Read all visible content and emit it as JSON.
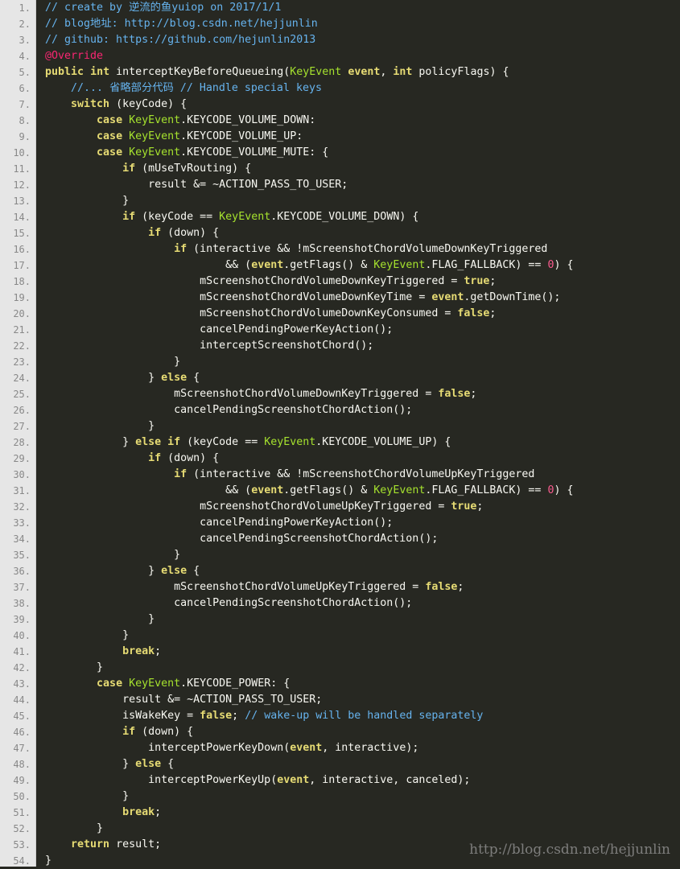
{
  "colors": {
    "background": "#272822",
    "gutter": "#e6e6e6",
    "line_number": "#888888",
    "comment": "#66b3ee",
    "keyword": "#e6db74",
    "type": "#a6e22e",
    "annotation": "#f92672",
    "number": "#f95b8e",
    "default": "#f8f8f2"
  },
  "watermark": "http://blog.csdn.net/hejjunlin",
  "code_lines": [
    {
      "num": "1.",
      "tokens": [
        {
          "t": "cmt",
          "v": "// create by 逆流的鱼yuiop on 2017/1/1"
        }
      ]
    },
    {
      "num": "2.",
      "tokens": [
        {
          "t": "cmt",
          "v": "// blog地址: http://blog.csdn.net/hejjunlin"
        }
      ]
    },
    {
      "num": "3.",
      "tokens": [
        {
          "t": "cmt",
          "v": "// github: https://github.com/hejunlin2013"
        }
      ]
    },
    {
      "num": "4.",
      "tokens": [
        {
          "t": "ann",
          "v": "@Override"
        }
      ]
    },
    {
      "num": "5.",
      "tokens": [
        {
          "t": "kw",
          "v": "public"
        },
        {
          "t": "def",
          "v": " "
        },
        {
          "t": "kw",
          "v": "int"
        },
        {
          "t": "def",
          "v": " interceptKeyBeforeQueueing("
        },
        {
          "t": "typ",
          "v": "KeyEvent"
        },
        {
          "t": "def",
          "v": " "
        },
        {
          "t": "kw",
          "v": "event"
        },
        {
          "t": "def",
          "v": ", "
        },
        {
          "t": "kw",
          "v": "int"
        },
        {
          "t": "def",
          "v": " policyFlags) {"
        }
      ]
    },
    {
      "num": "6.",
      "tokens": [
        {
          "t": "def",
          "v": "    "
        },
        {
          "t": "cmt",
          "v": "//... 省略部分代码 // Handle special keys"
        }
      ]
    },
    {
      "num": "7.",
      "tokens": [
        {
          "t": "def",
          "v": "    "
        },
        {
          "t": "kw",
          "v": "switch"
        },
        {
          "t": "def",
          "v": " (keyCode) {"
        }
      ]
    },
    {
      "num": "8.",
      "tokens": [
        {
          "t": "def",
          "v": "        "
        },
        {
          "t": "kw",
          "v": "case"
        },
        {
          "t": "def",
          "v": " "
        },
        {
          "t": "typ",
          "v": "KeyEvent"
        },
        {
          "t": "def",
          "v": ".KEYCODE_VOLUME_DOWN:"
        }
      ]
    },
    {
      "num": "9.",
      "tokens": [
        {
          "t": "def",
          "v": "        "
        },
        {
          "t": "kw",
          "v": "case"
        },
        {
          "t": "def",
          "v": " "
        },
        {
          "t": "typ",
          "v": "KeyEvent"
        },
        {
          "t": "def",
          "v": ".KEYCODE_VOLUME_UP:"
        }
      ]
    },
    {
      "num": "10.",
      "tokens": [
        {
          "t": "def",
          "v": "        "
        },
        {
          "t": "kw",
          "v": "case"
        },
        {
          "t": "def",
          "v": " "
        },
        {
          "t": "typ",
          "v": "KeyEvent"
        },
        {
          "t": "def",
          "v": ".KEYCODE_VOLUME_MUTE: {"
        }
      ]
    },
    {
      "num": "11.",
      "tokens": [
        {
          "t": "def",
          "v": "            "
        },
        {
          "t": "kw",
          "v": "if"
        },
        {
          "t": "def",
          "v": " (mUseTvRouting) {"
        }
      ]
    },
    {
      "num": "12.",
      "tokens": [
        {
          "t": "def",
          "v": "                result &= ~ACTION_PASS_TO_USER;"
        }
      ]
    },
    {
      "num": "13.",
      "tokens": [
        {
          "t": "def",
          "v": "            }"
        }
      ]
    },
    {
      "num": "14.",
      "tokens": [
        {
          "t": "def",
          "v": "            "
        },
        {
          "t": "kw",
          "v": "if"
        },
        {
          "t": "def",
          "v": " (keyCode == "
        },
        {
          "t": "typ",
          "v": "KeyEvent"
        },
        {
          "t": "def",
          "v": ".KEYCODE_VOLUME_DOWN) {"
        }
      ]
    },
    {
      "num": "15.",
      "tokens": [
        {
          "t": "def",
          "v": "                "
        },
        {
          "t": "kw",
          "v": "if"
        },
        {
          "t": "def",
          "v": " (down) {"
        }
      ]
    },
    {
      "num": "16.",
      "tokens": [
        {
          "t": "def",
          "v": "                    "
        },
        {
          "t": "kw",
          "v": "if"
        },
        {
          "t": "def",
          "v": " (interactive && !mScreenshotChordVolumeDownKeyTriggered"
        }
      ]
    },
    {
      "num": "17.",
      "tokens": [
        {
          "t": "def",
          "v": "                            && ("
        },
        {
          "t": "kw",
          "v": "event"
        },
        {
          "t": "def",
          "v": ".getFlags() & "
        },
        {
          "t": "typ",
          "v": "KeyEvent"
        },
        {
          "t": "def",
          "v": ".FLAG_FALLBACK) == "
        },
        {
          "t": "num",
          "v": "0"
        },
        {
          "t": "def",
          "v": ") {"
        }
      ]
    },
    {
      "num": "18.",
      "tokens": [
        {
          "t": "def",
          "v": "                        mScreenshotChordVolumeDownKeyTriggered = "
        },
        {
          "t": "kw",
          "v": "true"
        },
        {
          "t": "def",
          "v": ";"
        }
      ]
    },
    {
      "num": "19.",
      "tokens": [
        {
          "t": "def",
          "v": "                        mScreenshotChordVolumeDownKeyTime = "
        },
        {
          "t": "kw",
          "v": "event"
        },
        {
          "t": "def",
          "v": ".getDownTime();"
        }
      ]
    },
    {
      "num": "20.",
      "tokens": [
        {
          "t": "def",
          "v": "                        mScreenshotChordVolumeDownKeyConsumed = "
        },
        {
          "t": "kw",
          "v": "false"
        },
        {
          "t": "def",
          "v": ";"
        }
      ]
    },
    {
      "num": "21.",
      "tokens": [
        {
          "t": "def",
          "v": "                        cancelPendingPowerKeyAction();"
        }
      ]
    },
    {
      "num": "22.",
      "tokens": [
        {
          "t": "def",
          "v": "                        interceptScreenshotChord();"
        }
      ]
    },
    {
      "num": "23.",
      "tokens": [
        {
          "t": "def",
          "v": "                    }"
        }
      ]
    },
    {
      "num": "24.",
      "tokens": [
        {
          "t": "def",
          "v": "                } "
        },
        {
          "t": "kw",
          "v": "else"
        },
        {
          "t": "def",
          "v": " {"
        }
      ]
    },
    {
      "num": "25.",
      "tokens": [
        {
          "t": "def",
          "v": "                    mScreenshotChordVolumeDownKeyTriggered = "
        },
        {
          "t": "kw",
          "v": "false"
        },
        {
          "t": "def",
          "v": ";"
        }
      ]
    },
    {
      "num": "26.",
      "tokens": [
        {
          "t": "def",
          "v": "                    cancelPendingScreenshotChordAction();"
        }
      ]
    },
    {
      "num": "27.",
      "tokens": [
        {
          "t": "def",
          "v": "                }"
        }
      ]
    },
    {
      "num": "28.",
      "tokens": [
        {
          "t": "def",
          "v": "            } "
        },
        {
          "t": "kw",
          "v": "else"
        },
        {
          "t": "def",
          "v": " "
        },
        {
          "t": "kw",
          "v": "if"
        },
        {
          "t": "def",
          "v": " (keyCode == "
        },
        {
          "t": "typ",
          "v": "KeyEvent"
        },
        {
          "t": "def",
          "v": ".KEYCODE_VOLUME_UP) {"
        }
      ]
    },
    {
      "num": "29.",
      "tokens": [
        {
          "t": "def",
          "v": "                "
        },
        {
          "t": "kw",
          "v": "if"
        },
        {
          "t": "def",
          "v": " (down) {"
        }
      ]
    },
    {
      "num": "30.",
      "tokens": [
        {
          "t": "def",
          "v": "                    "
        },
        {
          "t": "kw",
          "v": "if"
        },
        {
          "t": "def",
          "v": " (interactive && !mScreenshotChordVolumeUpKeyTriggered"
        }
      ]
    },
    {
      "num": "31.",
      "tokens": [
        {
          "t": "def",
          "v": "                            && ("
        },
        {
          "t": "kw",
          "v": "event"
        },
        {
          "t": "def",
          "v": ".getFlags() & "
        },
        {
          "t": "typ",
          "v": "KeyEvent"
        },
        {
          "t": "def",
          "v": ".FLAG_FALLBACK) == "
        },
        {
          "t": "num",
          "v": "0"
        },
        {
          "t": "def",
          "v": ") {"
        }
      ]
    },
    {
      "num": "32.",
      "tokens": [
        {
          "t": "def",
          "v": "                        mScreenshotChordVolumeUpKeyTriggered = "
        },
        {
          "t": "kw",
          "v": "true"
        },
        {
          "t": "def",
          "v": ";"
        }
      ]
    },
    {
      "num": "33.",
      "tokens": [
        {
          "t": "def",
          "v": "                        cancelPendingPowerKeyAction();"
        }
      ]
    },
    {
      "num": "34.",
      "tokens": [
        {
          "t": "def",
          "v": "                        cancelPendingScreenshotChordAction();"
        }
      ]
    },
    {
      "num": "35.",
      "tokens": [
        {
          "t": "def",
          "v": "                    }"
        }
      ]
    },
    {
      "num": "36.",
      "tokens": [
        {
          "t": "def",
          "v": "                } "
        },
        {
          "t": "kw",
          "v": "else"
        },
        {
          "t": "def",
          "v": " {"
        }
      ]
    },
    {
      "num": "37.",
      "tokens": [
        {
          "t": "def",
          "v": "                    mScreenshotChordVolumeUpKeyTriggered = "
        },
        {
          "t": "kw",
          "v": "false"
        },
        {
          "t": "def",
          "v": ";"
        }
      ]
    },
    {
      "num": "38.",
      "tokens": [
        {
          "t": "def",
          "v": "                    cancelPendingScreenshotChordAction();"
        }
      ]
    },
    {
      "num": "39.",
      "tokens": [
        {
          "t": "def",
          "v": "                }"
        }
      ]
    },
    {
      "num": "40.",
      "tokens": [
        {
          "t": "def",
          "v": "            }"
        }
      ]
    },
    {
      "num": "41.",
      "tokens": [
        {
          "t": "def",
          "v": "            "
        },
        {
          "t": "kw",
          "v": "break"
        },
        {
          "t": "def",
          "v": ";"
        }
      ]
    },
    {
      "num": "42.",
      "tokens": [
        {
          "t": "def",
          "v": "        }"
        }
      ]
    },
    {
      "num": "43.",
      "tokens": [
        {
          "t": "def",
          "v": "        "
        },
        {
          "t": "kw",
          "v": "case"
        },
        {
          "t": "def",
          "v": " "
        },
        {
          "t": "typ",
          "v": "KeyEvent"
        },
        {
          "t": "def",
          "v": ".KEYCODE_POWER: {"
        }
      ]
    },
    {
      "num": "44.",
      "tokens": [
        {
          "t": "def",
          "v": "            result &= ~ACTION_PASS_TO_USER;"
        }
      ]
    },
    {
      "num": "45.",
      "tokens": [
        {
          "t": "def",
          "v": "            isWakeKey = "
        },
        {
          "t": "kw",
          "v": "false"
        },
        {
          "t": "def",
          "v": "; "
        },
        {
          "t": "cmt",
          "v": "// wake-up will be handled separately"
        }
      ]
    },
    {
      "num": "46.",
      "tokens": [
        {
          "t": "def",
          "v": "            "
        },
        {
          "t": "kw",
          "v": "if"
        },
        {
          "t": "def",
          "v": " (down) {"
        }
      ]
    },
    {
      "num": "47.",
      "tokens": [
        {
          "t": "def",
          "v": "                interceptPowerKeyDown("
        },
        {
          "t": "kw",
          "v": "event"
        },
        {
          "t": "def",
          "v": ", interactive);"
        }
      ]
    },
    {
      "num": "48.",
      "tokens": [
        {
          "t": "def",
          "v": "            } "
        },
        {
          "t": "kw",
          "v": "else"
        },
        {
          "t": "def",
          "v": " {"
        }
      ]
    },
    {
      "num": "49.",
      "tokens": [
        {
          "t": "def",
          "v": "                interceptPowerKeyUp("
        },
        {
          "t": "kw",
          "v": "event"
        },
        {
          "t": "def",
          "v": ", interactive, canceled);"
        }
      ]
    },
    {
      "num": "50.",
      "tokens": [
        {
          "t": "def",
          "v": "            }"
        }
      ]
    },
    {
      "num": "51.",
      "tokens": [
        {
          "t": "def",
          "v": "            "
        },
        {
          "t": "kw",
          "v": "break"
        },
        {
          "t": "def",
          "v": ";"
        }
      ]
    },
    {
      "num": "52.",
      "tokens": [
        {
          "t": "def",
          "v": "        }"
        }
      ]
    },
    {
      "num": "53.",
      "tokens": [
        {
          "t": "def",
          "v": "    "
        },
        {
          "t": "kw",
          "v": "return"
        },
        {
          "t": "def",
          "v": " result;"
        }
      ]
    },
    {
      "num": "54.",
      "tokens": [
        {
          "t": "def",
          "v": "}"
        }
      ]
    }
  ]
}
